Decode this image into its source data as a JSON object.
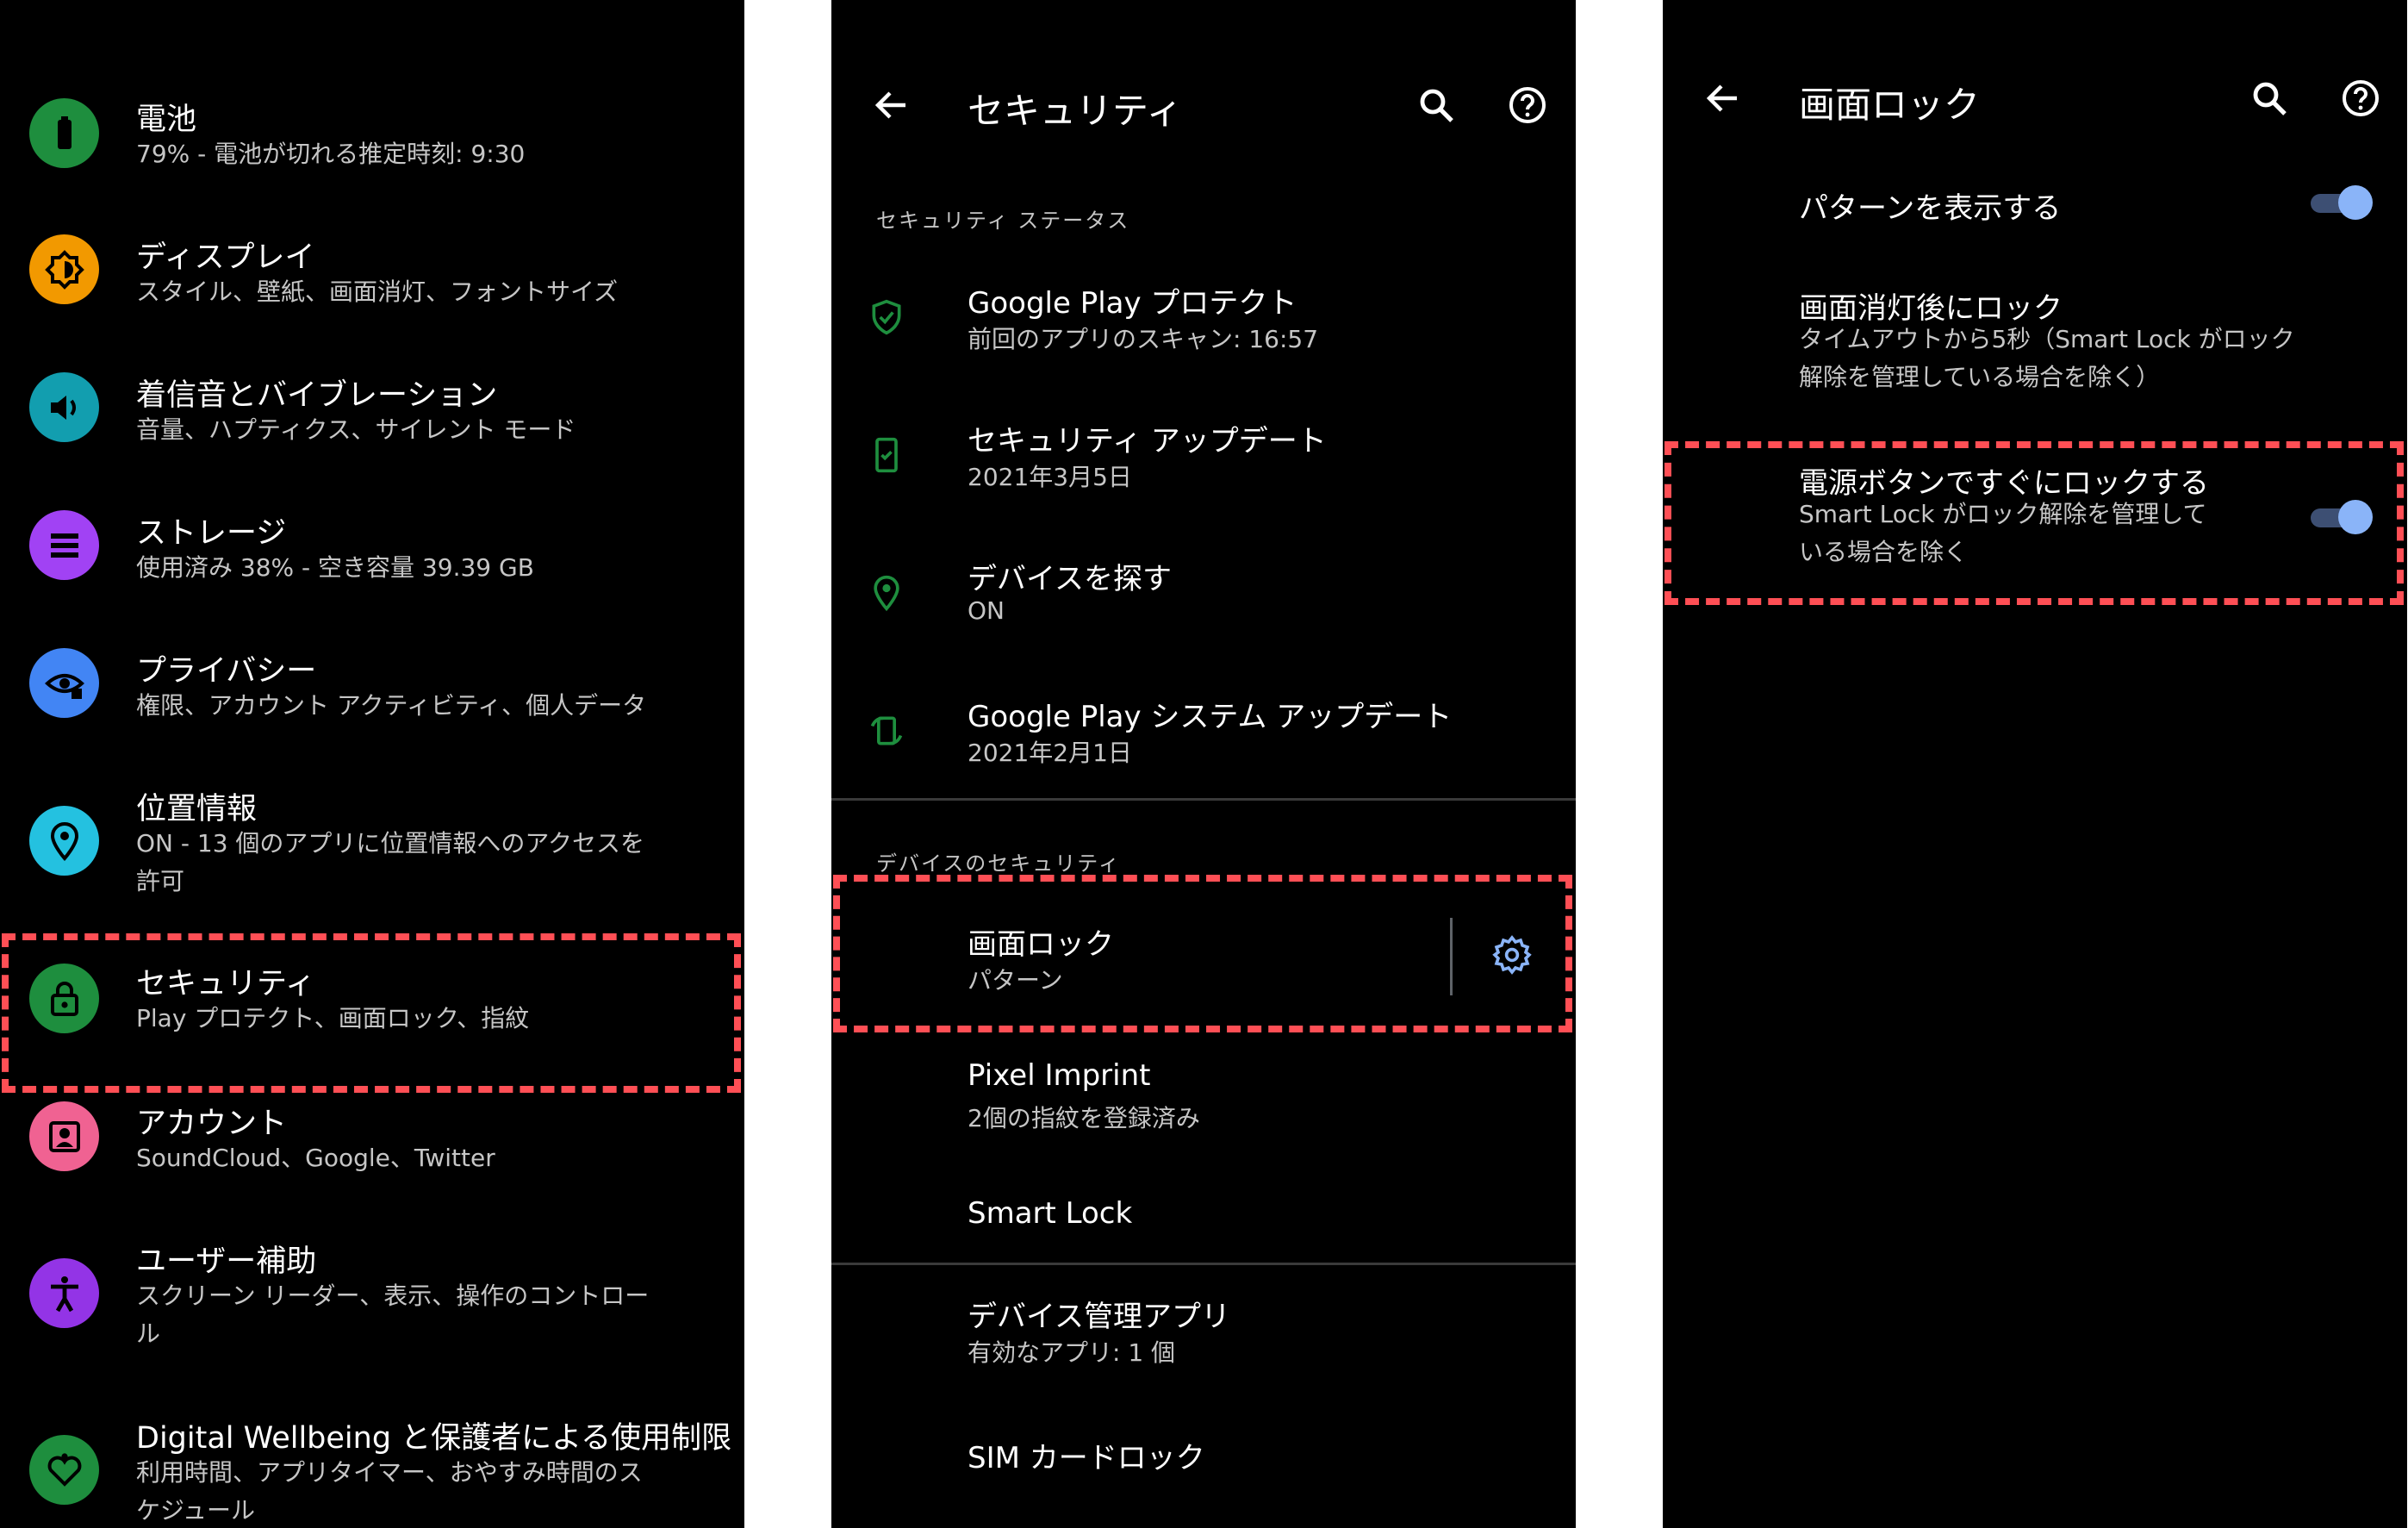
{
  "settings": {
    "items": [
      {
        "title": "電池",
        "subtitle": "79% - 電池が切れる推定時刻: 9:30",
        "icon": "battery-icon",
        "color": "#1e8e3e"
      },
      {
        "title": "ディスプレイ",
        "subtitle": "スタイル、壁紙、画面消灯、フォントサイズ",
        "icon": "display-brightness-icon",
        "color": "#f29900"
      },
      {
        "title": "着信音とバイブレーション",
        "subtitle": "音量、ハプティクス、サイレント モード",
        "icon": "volume-icon",
        "color": "#129eaf"
      },
      {
        "title": "ストレージ",
        "subtitle": "使用済み 38% - 空き容量 39.39 GB",
        "icon": "storage-icon",
        "color": "#a142f4"
      },
      {
        "title": "プライバシー",
        "subtitle": "権限、アカウント アクティビティ、個人データ",
        "icon": "privacy-eye-icon",
        "color": "#4285f4"
      },
      {
        "title": "位置情報",
        "subtitle": "ON - 13 個のアプリに位置情報へのアクセスを\n許可",
        "icon": "location-pin-icon",
        "color": "#24c1e0"
      },
      {
        "title": "セキュリティ",
        "subtitle": "Play プロテクト、画面ロック、指紋",
        "icon": "lock-icon",
        "color": "#1e8e3e"
      },
      {
        "title": "アカウント",
        "subtitle": "SoundCloud、Google、Twitter",
        "icon": "account-box-icon",
        "color": "#f06292"
      },
      {
        "title": "ユーザー補助",
        "subtitle": "スクリーン リーダー、表示、操作のコントロー\nル",
        "icon": "accessibility-icon",
        "color": "#9334e6"
      },
      {
        "title": "Digital Wellbeing と保護者による使用制限",
        "subtitle": "利用時間、アプリタイマー、おやすみ時間のス\nケジュール",
        "icon": "wellbeing-heart-icon",
        "color": "#1e8e3e"
      }
    ]
  },
  "security": {
    "title": "セキュリティ",
    "status_header": "セキュリティ ステータス",
    "status_items": [
      {
        "title": "Google Play プロテクト",
        "subtitle": "前回のアプリのスキャン: 16:57",
        "icon": "shield-check-icon"
      },
      {
        "title": "セキュリティ アップデート",
        "subtitle": "2021年3月5日",
        "icon": "phone-check-icon"
      },
      {
        "title": "デバイスを探す",
        "subtitle": "ON",
        "icon": "location-pin-icon"
      },
      {
        "title": "Google Play システム アップデート",
        "subtitle": "2021年2月1日",
        "icon": "system-update-icon"
      }
    ],
    "device_header": "デバイスのセキュリティ",
    "screen_lock": {
      "title": "画面ロック",
      "subtitle": "パターン"
    },
    "pixel_imprint": {
      "title": "Pixel Imprint",
      "subtitle": "2個の指紋を登録済み"
    },
    "smart_lock": {
      "title": "Smart Lock"
    },
    "device_admin": {
      "title": "デバイス管理アプリ",
      "subtitle": "有効なアプリ: 1 個"
    },
    "sim_lock": {
      "title": "SIM カードロック"
    }
  },
  "screen_lock": {
    "title": "画面ロック",
    "show_pattern": {
      "title": "パターンを表示する",
      "on": true
    },
    "lock_after": {
      "title": "画面消灯後にロック",
      "subtitle": "タイムアウトから5秒（Smart Lock がロック\n解除を管理している場合を除く）"
    },
    "power_lock": {
      "title": "電源ボタンですぐにロックする",
      "subtitle": "Smart Lock がロック解除を管理して\nいる場合を除く",
      "on": true
    }
  },
  "colors": {
    "accent_green": "#1e8e3e",
    "accent_blue": "#8ab4f8",
    "highlight_dash": "#ff4f55"
  }
}
